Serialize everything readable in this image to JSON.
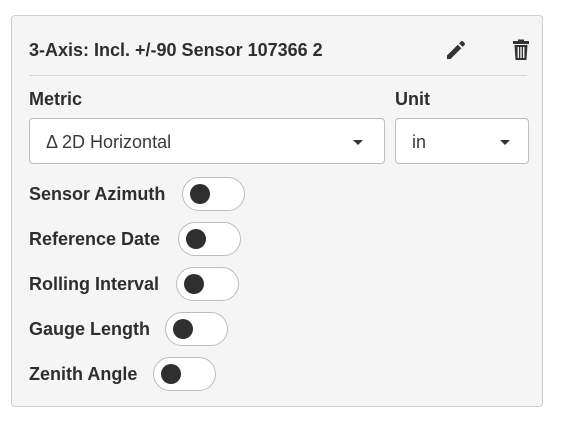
{
  "panel": {
    "title": "3-Axis: Incl. +/-90 Sensor 107366 2",
    "edit_icon": "pencil-icon",
    "delete_icon": "trash-icon"
  },
  "metric": {
    "label": "Metric",
    "value": "Δ 2D Horizontal"
  },
  "unit": {
    "label": "Unit",
    "value": "in"
  },
  "toggles": [
    {
      "label": "Sensor Azimuth",
      "enabled": false
    },
    {
      "label": "Reference Date",
      "enabled": false
    },
    {
      "label": "Rolling Interval",
      "enabled": false
    },
    {
      "label": "Gauge Length",
      "enabled": false
    },
    {
      "label": "Zenith Angle",
      "enabled": false
    }
  ],
  "colors": {
    "panel_bg": "#f5f5f5",
    "border": "#cfcfcf",
    "text": "#2e2e2e",
    "knob": "#2f2f2f"
  }
}
